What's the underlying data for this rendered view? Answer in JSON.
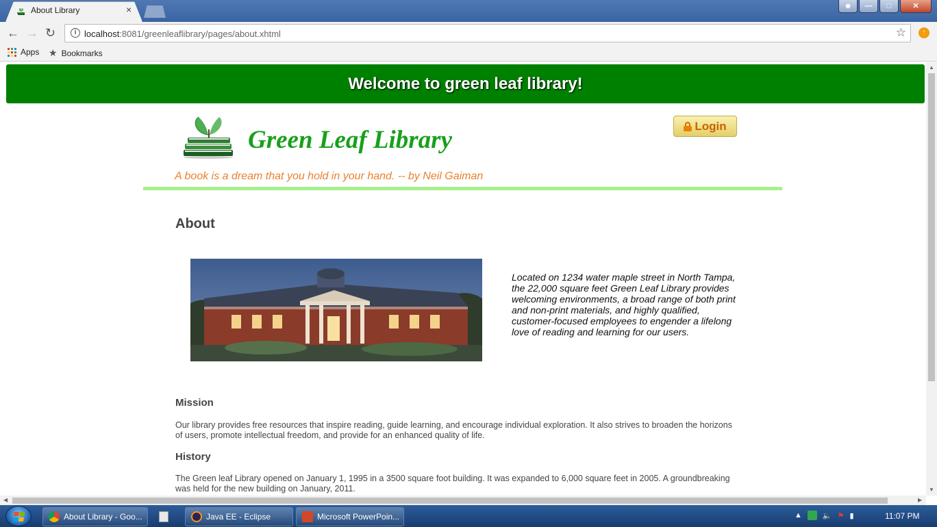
{
  "browser": {
    "tab_title": "About Library",
    "tab_close": "×",
    "url_host": "localhost",
    "url_rest": ":8081/greenleaflibrary/pages/about.xhtml",
    "bookmarks": [
      {
        "label": "Apps",
        "icon": "apps-icon"
      },
      {
        "label": "Bookmarks",
        "icon": "star-icon"
      }
    ]
  },
  "page": {
    "banner": "Welcome to green leaf library!",
    "logo_text": "Green Leaf Library",
    "login_label": "Login",
    "quote": "A book is a dream that you hold in your hand. -- by Neil Gaiman",
    "about_heading": "About",
    "about_text": "Located on 1234 water maple street in North Tampa, the 22,000 square feet Green Leaf Library provides welcoming environments, a broad range of both print and non-print materials, and highly qualified, customer-focused employees to engender a lifelong love of reading and learning for our users.",
    "mission_heading": "Mission",
    "mission_text": "Our library provides free resources that inspire reading, guide learning, and encourage individual exploration. It also strives to broaden the horizons of users, promote intellectual freedom, and provide for an enhanced quality of life.",
    "history_heading": "History",
    "history_text": "The Green leaf Library opened on January 1, 1995 in a 3500 square foot building. It was expanded to 6,000 square feet in 2005. A groundbreaking was held for the new building on January, 2011."
  },
  "taskbar": {
    "tasks": [
      {
        "label": "About Library - Goo...",
        "icon": "chrome-icon"
      },
      {
        "label": "",
        "icon": "calculator-icon"
      },
      {
        "label": "Java EE - Eclipse",
        "icon": "eclipse-icon"
      },
      {
        "label": "Microsoft PowerPoin...",
        "icon": "powerpoint-icon"
      }
    ],
    "clock": "11:07 PM"
  },
  "colors": {
    "banner_green": "#008000",
    "logo_green": "#18a01c",
    "quote_orange": "#e8812d",
    "divider_green": "#a6f18a"
  }
}
